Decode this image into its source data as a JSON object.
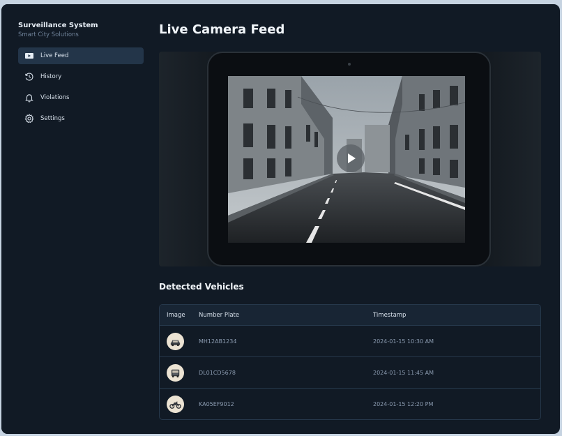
{
  "sidebar": {
    "title": "Surveillance System",
    "subtitle": "Smart City Solutions",
    "items": [
      {
        "label": "Live Feed",
        "icon": "play-icon",
        "active": true
      },
      {
        "label": "History",
        "icon": "history-icon",
        "active": false
      },
      {
        "label": "Violations",
        "icon": "bell-icon",
        "active": false
      },
      {
        "label": "Settings",
        "icon": "gear-icon",
        "active": false
      }
    ]
  },
  "main": {
    "title": "Live Camera Feed",
    "video": {
      "play_icon": "play-icon"
    },
    "detected": {
      "title": "Detected Vehicles",
      "columns": [
        "Image",
        "Number Plate",
        "Timestamp"
      ],
      "rows": [
        {
          "icon": "car-icon",
          "plate": "MH12AB1234",
          "timestamp": "2024-01-15 10:30 AM"
        },
        {
          "icon": "truck-icon",
          "plate": "DL01CD5678",
          "timestamp": "2024-01-15 11:45 AM"
        },
        {
          "icon": "motorcycle-icon",
          "plate": "KA05EF9012",
          "timestamp": "2024-01-15 12:20 PM"
        }
      ]
    }
  },
  "colors": {
    "background": "#111a25",
    "active_nav": "#233549",
    "table_header": "#182534",
    "border": "#26384b"
  }
}
